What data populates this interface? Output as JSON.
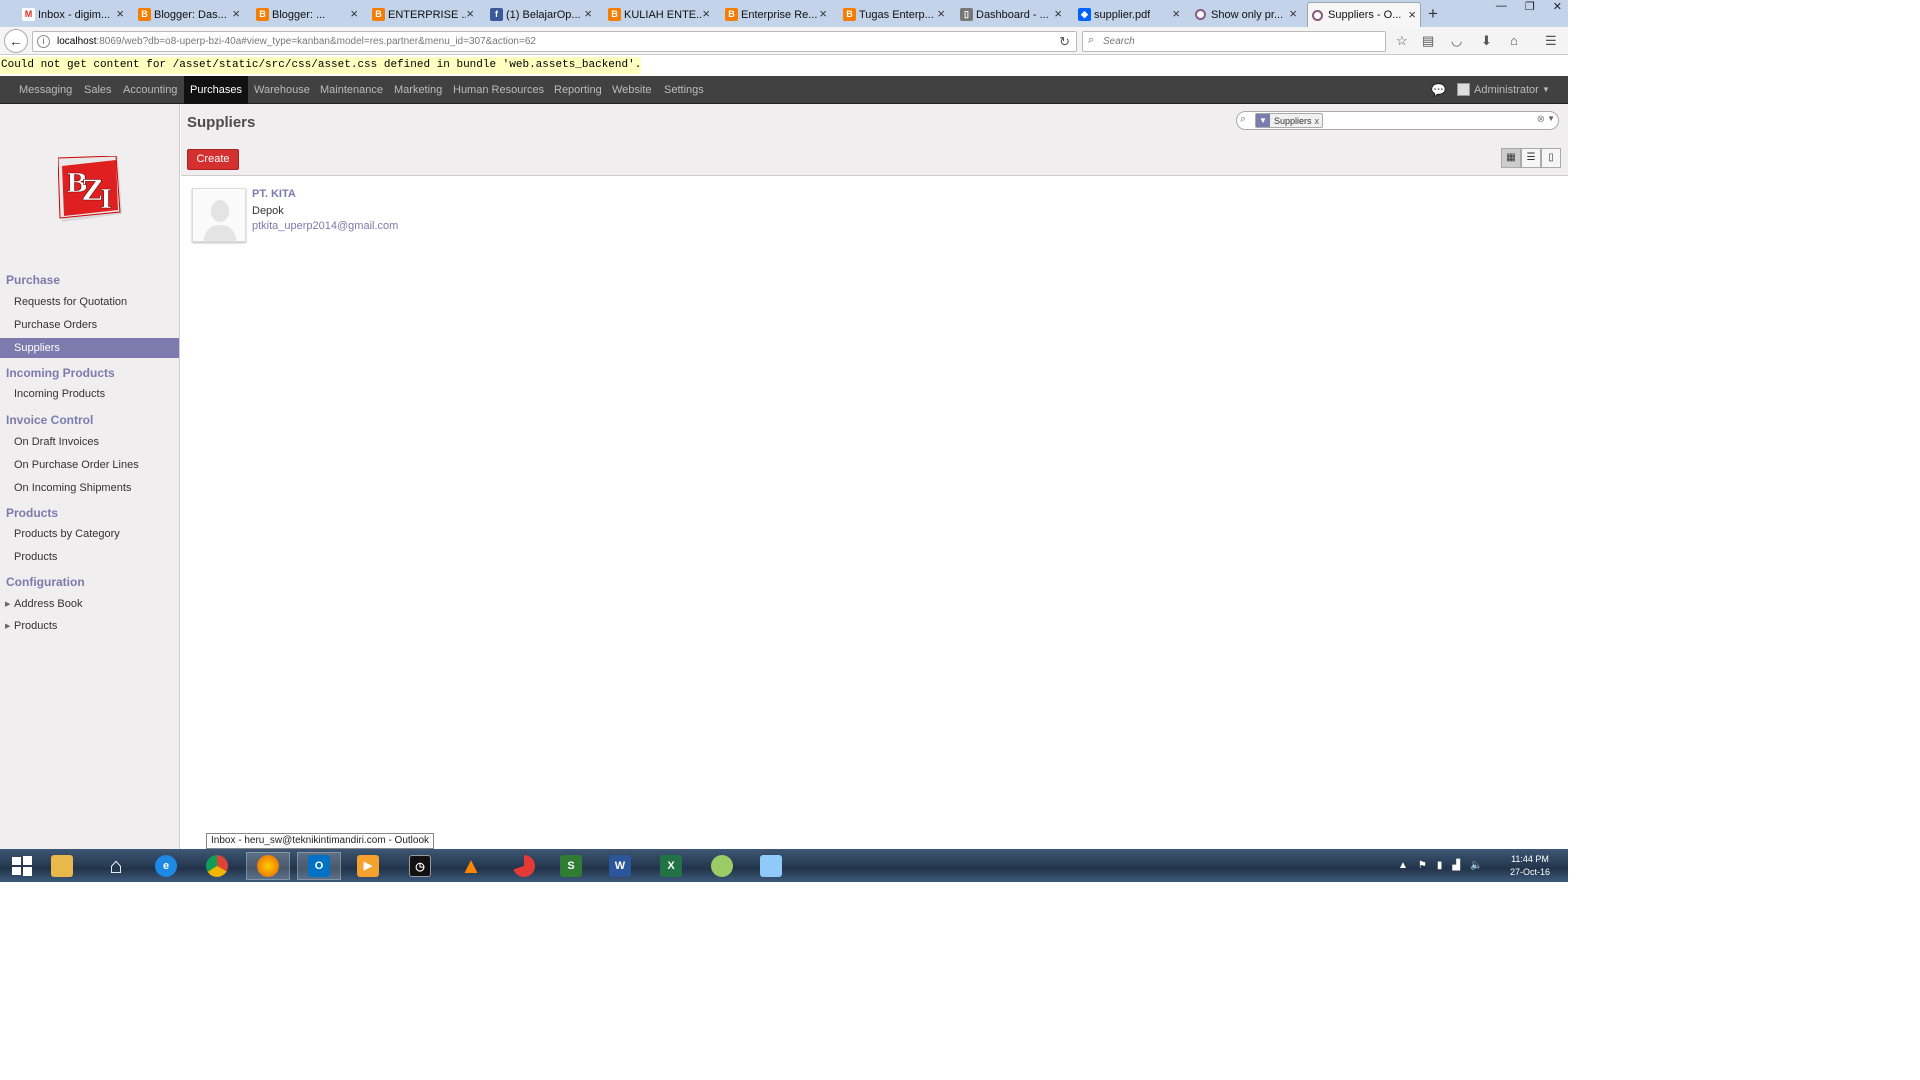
{
  "browser": {
    "tabs": [
      {
        "title": "Inbox - digim...",
        "icon": "gmail-icon",
        "color": "#d93025"
      },
      {
        "title": "Blogger: Das...",
        "icon": "blogger-icon",
        "color": "#f57d00"
      },
      {
        "title": "Blogger: ...",
        "icon": "blogger-icon",
        "color": "#f57d00"
      },
      {
        "title": "ENTERPRISE ...",
        "icon": "blogger-icon",
        "color": "#f57d00"
      },
      {
        "title": "(1) BelajarOp...",
        "icon": "facebook-icon",
        "color": "#3b5998"
      },
      {
        "title": "KULIAH ENTE...",
        "icon": "blogger-icon",
        "color": "#f57d00"
      },
      {
        "title": "Enterprise Re...",
        "icon": "blogger-icon",
        "color": "#f57d00"
      },
      {
        "title": "Tugas Enterp...",
        "icon": "blogger-icon",
        "color": "#f57d00"
      },
      {
        "title": "Dashboard - ...",
        "icon": "book-icon",
        "color": "#555555"
      },
      {
        "title": "supplier.pdf",
        "icon": "dropbox-icon",
        "color": "#0061ff"
      },
      {
        "title": "Show only pr...",
        "icon": "odoo-icon",
        "color": "#875a7b"
      },
      {
        "title": "Suppliers - O...",
        "icon": "odoo-icon",
        "color": "#875a7b"
      }
    ],
    "url_host": "localhost",
    "url_rest": ":8069/web?db=o8-uperp-bzi-40a#view_type=kanban&model=res.partner&menu_id=307&action=62",
    "search_placeholder": "Search"
  },
  "error_message": "Could not get content for /asset/static/src/css/asset.css defined in bundle 'web.assets_backend'.",
  "top_menu": {
    "items": [
      "Messaging",
      "Sales",
      "Accounting",
      "Purchases",
      "Warehouse",
      "Maintenance",
      "Marketing",
      "Human Resources",
      "Reporting",
      "Website",
      "Settings"
    ],
    "active": "Purchases",
    "user": "Administrator"
  },
  "logo": {
    "text_b": "B",
    "text_z": "Z",
    "text_i": "I"
  },
  "sidebar": {
    "purchase": {
      "header": "Purchase",
      "items": [
        "Requests for Quotation",
        "Purchase Orders",
        "Suppliers"
      ]
    },
    "incoming": {
      "header": "Incoming Products",
      "items": [
        "Incoming Products"
      ]
    },
    "invoice": {
      "header": "Invoice Control",
      "items": [
        "On Draft Invoices",
        "On Purchase Order Lines",
        "On Incoming Shipments"
      ]
    },
    "products": {
      "header": "Products",
      "items": [
        "Products by Category",
        "Products"
      ]
    },
    "configuration": {
      "header": "Configuration",
      "items": [
        "Address Book",
        "Products"
      ]
    },
    "active_item": "Suppliers"
  },
  "control_panel": {
    "title": "Suppliers",
    "create_label": "Create",
    "facet_label": "Suppliers",
    "facet_remove": "x"
  },
  "kanban": {
    "records": [
      {
        "name": "PT. KITA",
        "city": "Depok",
        "email": "ptkita_uperp2014@gmail.com"
      }
    ]
  },
  "tooltip": "Inbox - heru_sw@teknikintimandiri.com - Outlook",
  "taskbar": {
    "apps": [
      {
        "name": "file-explorer-icon",
        "label": "",
        "color": "#e8b84a"
      },
      {
        "name": "home-icon",
        "label": "",
        "color": "#ffffff"
      },
      {
        "name": "internet-explorer-icon",
        "label": "e",
        "color": "#1e88e5"
      },
      {
        "name": "chrome-icon",
        "label": "",
        "color": "#db4437"
      },
      {
        "name": "firefox-icon",
        "label": "",
        "color": "#e66000"
      },
      {
        "name": "outlook-icon",
        "label": "O",
        "color": "#0072c6"
      },
      {
        "name": "media-player-icon",
        "label": "▶",
        "color": "#f4a22d"
      },
      {
        "name": "clock-app-icon",
        "label": "",
        "color": "#111111"
      },
      {
        "name": "vlc-icon",
        "label": "",
        "color": "#ff8800"
      },
      {
        "name": "loading-app-icon",
        "label": "",
        "color": "#e53935"
      },
      {
        "name": "slides-icon",
        "label": "S",
        "color": "#2e7d32"
      },
      {
        "name": "word-icon",
        "label": "W",
        "color": "#2b579a"
      },
      {
        "name": "excel-icon",
        "label": "X",
        "color": "#217346"
      },
      {
        "name": "paint-icon",
        "label": "",
        "color": "#9ccc65"
      },
      {
        "name": "monitor-app-icon",
        "label": "",
        "color": "#90caf9"
      }
    ],
    "time": "11:44 PM",
    "date": "27-Oct-16"
  }
}
